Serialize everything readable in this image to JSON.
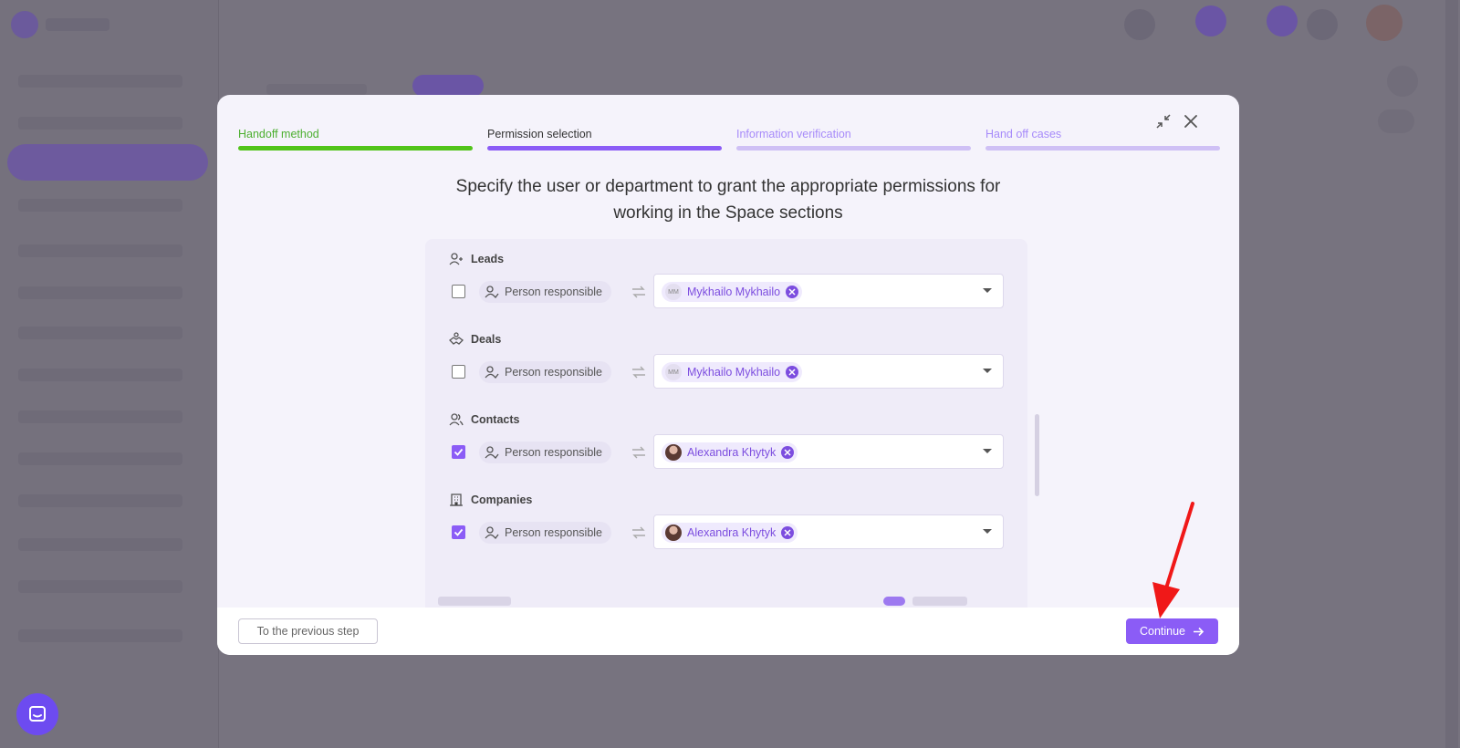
{
  "steps": [
    {
      "label": "Handoff method",
      "state": "done"
    },
    {
      "label": "Permission selection",
      "state": "current"
    },
    {
      "label": "Information verification",
      "state": "todo"
    },
    {
      "label": "Hand off cases",
      "state": "todo"
    }
  ],
  "heading": {
    "line1": "Specify the user or department to grant the appropriate permissions for",
    "line2": "working in the Space sections"
  },
  "sections": [
    {
      "title": "Leads",
      "icon": "user-plus-icon",
      "checked": false,
      "role": "Person responsible",
      "user": "Mykhailo Mykhailo",
      "initials": "MM"
    },
    {
      "title": "Deals",
      "icon": "handshake-icon",
      "checked": false,
      "role": "Person responsible",
      "user": "Mykhailo Mykhailo",
      "initials": "MM"
    },
    {
      "title": "Contacts",
      "icon": "users-icon",
      "checked": true,
      "role": "Person responsible",
      "user": "Alexandra Khytyk",
      "initials": ""
    },
    {
      "title": "Companies",
      "icon": "building-icon",
      "checked": true,
      "role": "Person responsible",
      "user": "Alexandra Khytyk",
      "initials": ""
    }
  ],
  "footer": {
    "prev_label": "To the previous step",
    "continue_label": "Continue"
  },
  "colors": {
    "accent": "#8b5cf6",
    "done": "#52c41a",
    "todo": "#cfc0f5"
  }
}
